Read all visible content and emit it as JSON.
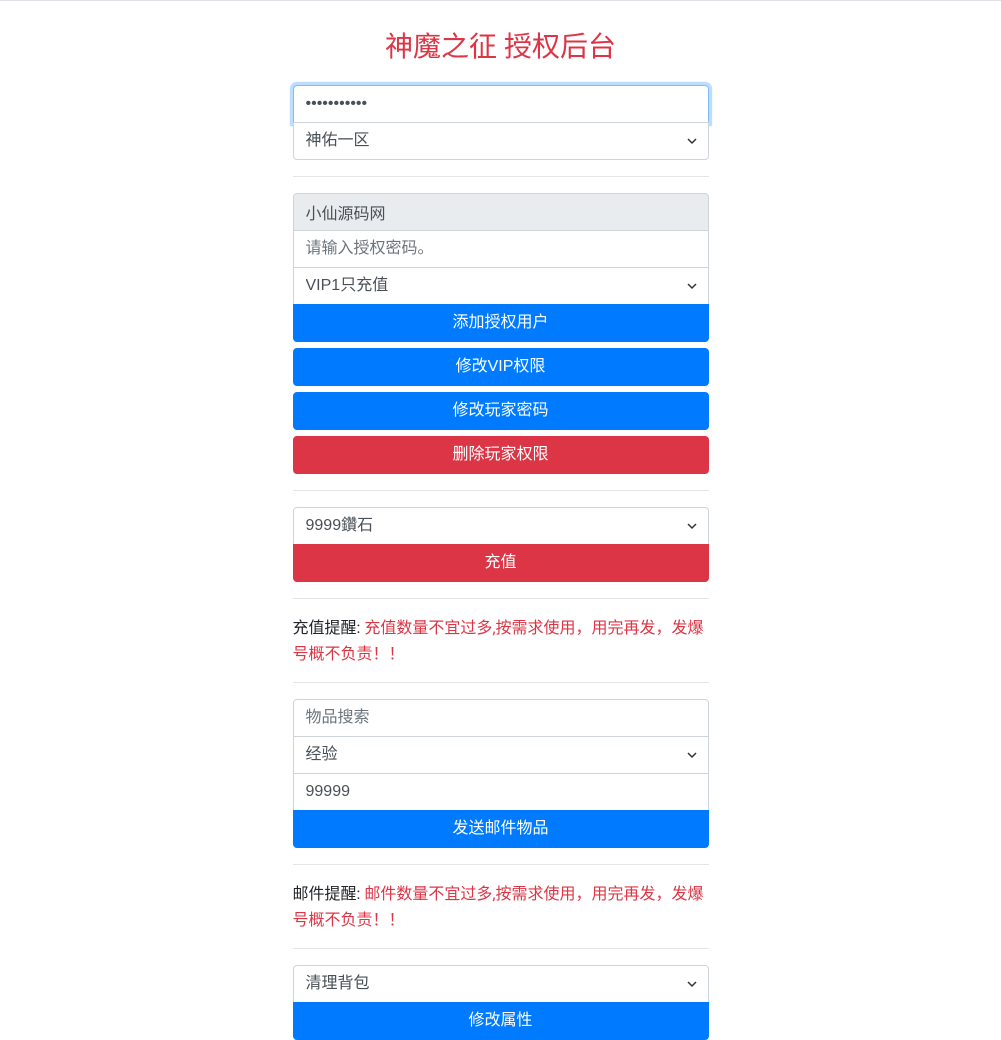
{
  "page_title": "神魔之征 授权后台",
  "section1": {
    "password_value": "•••••••••••",
    "server_select": "神佑一区"
  },
  "section2": {
    "username_readonly": "小仙源码网",
    "auth_password_placeholder": "请输入授权密码。",
    "vip_select": "VIP1只充值",
    "btn_add_auth_user": "添加授权用户",
    "btn_modify_vip": "修改VIP权限",
    "btn_modify_player_pw": "修改玩家密码",
    "btn_delete_player_perm": "删除玩家权限"
  },
  "section3": {
    "recharge_select": "9999鑽石",
    "btn_recharge": "充值"
  },
  "recharge_reminder": {
    "label": "充值提醒: ",
    "text": "充值数量不宜过多,按需求使用，用完再发，发爆号概不负责！！"
  },
  "section4": {
    "item_search_placeholder": "物品搜索",
    "item_select": "经验",
    "item_quantity": "99999",
    "btn_send_mail": "发送邮件物品"
  },
  "mail_reminder": {
    "label": "邮件提醒: ",
    "text": "邮件数量不宜过多,按需求使用，用完再发，发爆号概不负责！！"
  },
  "section5": {
    "action_select": "清理背包",
    "btn_modify_attr": "修改属性"
  }
}
